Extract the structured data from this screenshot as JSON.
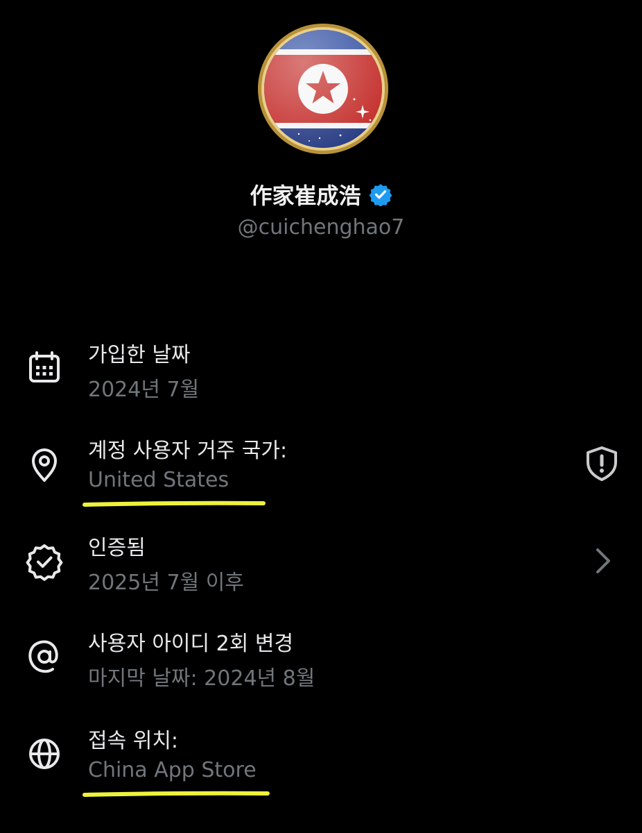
{
  "profile": {
    "display_name": "作家崔成浩",
    "handle": "@cuichenghao7",
    "avatar_icon": "north-korea-flag-avatar",
    "verified_icon": "verified-badge-icon"
  },
  "rows": [
    {
      "title": "가입한 날짜",
      "value": "2024년 7월",
      "icon": "calendar-icon"
    },
    {
      "title": "계정 사용자 거주 국가:",
      "value": "United States",
      "icon": "location-pin-icon",
      "right_icon": "shield-alert-icon"
    },
    {
      "title": "인증됨",
      "value": "2025년 7월 이후",
      "icon": "verified-icon",
      "right_icon": "chevron-right-icon"
    },
    {
      "title": "사용자 아이디 2회 변경",
      "value": "마지막 날짜: 2024년 8월",
      "icon": "at-sign-icon"
    },
    {
      "title": "접속 위치:",
      "value": "China App Store",
      "icon": "globe-icon"
    }
  ],
  "colors": {
    "background": "#000000",
    "primary_text": "#e7e9ea",
    "secondary_text": "#71767b",
    "verified_blue": "#1d9bf0",
    "highlight_yellow": "#eef23a"
  }
}
